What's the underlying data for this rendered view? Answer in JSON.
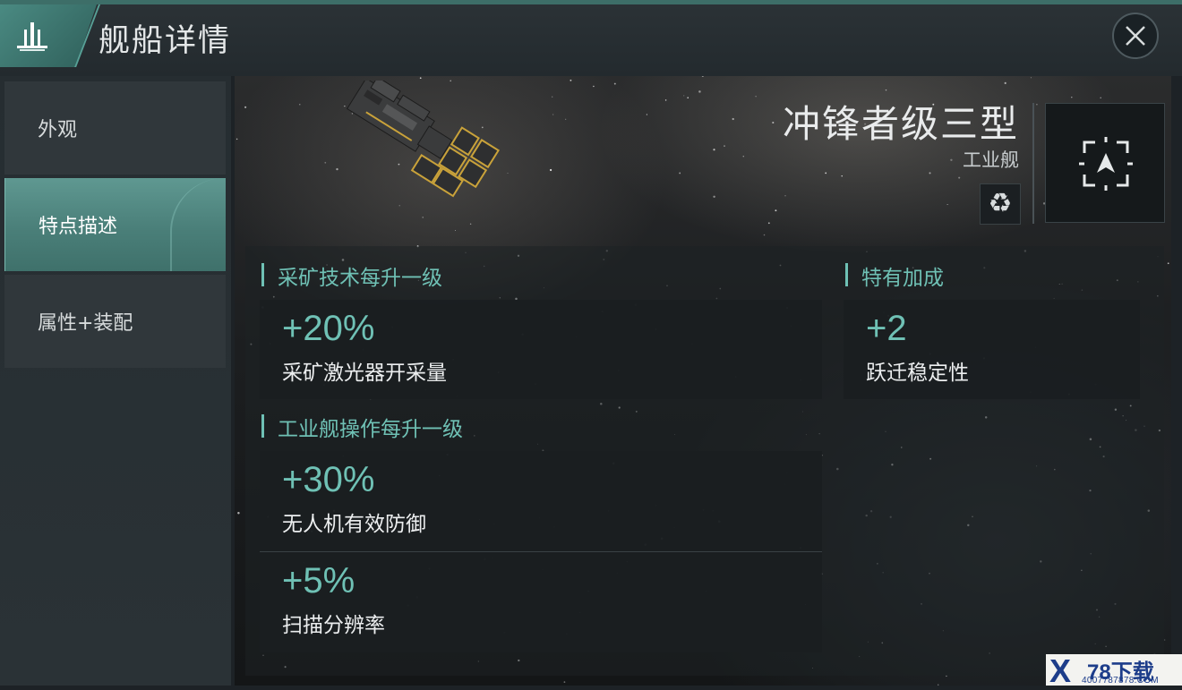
{
  "header": {
    "title": "舰船详情",
    "left_icon": "fleet-icon",
    "close_icon": "close-icon"
  },
  "sidebar": {
    "items": [
      {
        "label": "外观",
        "active": false
      },
      {
        "label": "特点描述",
        "active": true
      },
      {
        "label": "属性+装配",
        "active": false
      }
    ]
  },
  "ship": {
    "name": "冲锋者级三型",
    "class": "工业舰",
    "recycle_icon": "recycle-icon",
    "locate_icon": "locate-icon"
  },
  "sections": [
    {
      "title": "采矿技术每升一级",
      "bonuses": [
        {
          "value": "+20%",
          "label": "采矿激光器开采量"
        }
      ]
    },
    {
      "title": "特有加成",
      "bonuses": [
        {
          "value": "+2",
          "label": "跃迁稳定性"
        }
      ]
    },
    {
      "title": "工业舰操作每升一级",
      "bonuses": [
        {
          "value": "+30%",
          "label": "无人机有效防御"
        },
        {
          "value": "+5%",
          "label": "扫描分辨率"
        }
      ]
    }
  ],
  "watermark": {
    "brand": "78下载",
    "url": "4007787878.COM"
  },
  "colors": {
    "accent": "#6fc1b5",
    "active_tab": "#5f9891",
    "header_tab": "#4a8a82"
  }
}
